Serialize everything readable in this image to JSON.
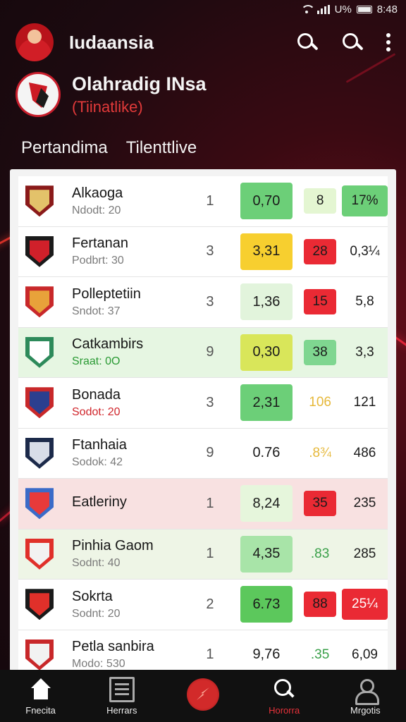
{
  "status_bar": {
    "battery": "U%",
    "time": "8:48"
  },
  "app": {
    "title": "Iudaansia"
  },
  "league": {
    "name": "Olahradig INsa",
    "subtitle": "(Tiinatlike)"
  },
  "tabs": [
    {
      "label": "Pertandima"
    },
    {
      "label": "Tilenttlive"
    }
  ],
  "standings": [
    {
      "team": "Alkaoga",
      "sub": "Ndodt: 20",
      "sub_color": "gray",
      "crest": [
        "#8a1a1a",
        "#e3c26a"
      ],
      "gp": "1",
      "odds": "0,70",
      "odds_bg": "#6ccf78",
      "v2": "8",
      "v2_bg": "#e4f6d2",
      "v3": "17%",
      "v3_bg": "#6ccf78",
      "row_bg": ""
    },
    {
      "team": "Fertanan",
      "sub": "Podbrt: 30",
      "sub_color": "gray",
      "crest": [
        "#1a1a1a",
        "#d0202a"
      ],
      "gp": "3",
      "odds": "3,31",
      "odds_bg": "#f7cf2f",
      "v2": "28",
      "v2_bg": "#ea2a34",
      "v3": "0,3¼",
      "v3_bg": "",
      "row_bg": ""
    },
    {
      "team": "Polleptetiin",
      "sub": "Sndot: 37",
      "sub_color": "gray",
      "crest": [
        "#c8282a",
        "#e8a23a"
      ],
      "gp": "3",
      "odds": "1,36",
      "odds_bg": "#e2f4dc",
      "v2": "15",
      "v2_bg": "#ea2a34",
      "v3": "5,8",
      "v3_bg": "",
      "row_bg": ""
    },
    {
      "team": "Catkambirs",
      "sub": "Sraat: 0O",
      "sub_color": "green",
      "crest": [
        "#2d8a5a",
        "#ffffff"
      ],
      "gp": "9",
      "odds": "0,30",
      "odds_bg": "#d9e65a",
      "v2": "38",
      "v2_bg": "#7fd690",
      "v3": "3,3",
      "v3_bg": "",
      "row_bg": "hl-green"
    },
    {
      "team": "Bonada",
      "sub": "Sodot: 20",
      "sub_color": "red",
      "crest": [
        "#c8282a",
        "#2b3f8f"
      ],
      "gp": "3",
      "odds": "2,31",
      "odds_bg": "#6ccf78",
      "v2": "106",
      "v2_bg": "",
      "v3": "121",
      "v3_bg": "",
      "row_bg": ""
    },
    {
      "team": "Ftanhaia",
      "sub": "Sodok: 42",
      "sub_color": "gray",
      "crest": [
        "#1c2a4a",
        "#d8dde8"
      ],
      "gp": "9",
      "odds": "0.76",
      "odds_bg": "",
      "v2": ".8¾",
      "v2_bg": "",
      "v3": "486",
      "v3_bg": "",
      "row_bg": ""
    },
    {
      "team": "Eatleriny",
      "sub": "",
      "sub_color": "gray",
      "crest": [
        "#3a6bc8",
        "#e83a3a"
      ],
      "gp": "1",
      "odds": "8,24",
      "odds_bg": "#e6f6dc",
      "v2": "35",
      "v2_bg": "#ea2a34",
      "v3": "235",
      "v3_bg": "",
      "row_bg": "hl-red"
    },
    {
      "team": "Pinhia Gaom",
      "sub": "Sodnt: 40",
      "sub_color": "gray",
      "crest": [
        "#e0302a",
        "#f2f2f2"
      ],
      "gp": "1",
      "odds": "4,35",
      "odds_bg": "#a8e4a8",
      "v2": ".83",
      "v2_bg": "",
      "v3": "285",
      "v3_bg": "",
      "row_bg": "hl-lime"
    },
    {
      "team": "Sokrta",
      "sub": "Sodnt: 20",
      "sub_color": "gray",
      "crest": [
        "#1a1a1a",
        "#e0302a"
      ],
      "gp": "2",
      "odds": "6.73",
      "odds_bg": "#5cc85c",
      "v2": "88",
      "v2_bg": "#ea2a34",
      "v3": "25¼",
      "v3_bg": "#ea2a34",
      "row_bg": ""
    },
    {
      "team": "Petla sanbira",
      "sub": "Modo: 530",
      "sub_color": "gray",
      "crest": [
        "#c8282a",
        "#f2f2f2"
      ],
      "gp": "1",
      "odds": "9,76",
      "odds_bg": "",
      "v2": ".35",
      "v2_bg": "",
      "v3": "6,09",
      "v3_bg": "",
      "row_bg": ""
    }
  ],
  "bottom_nav": [
    {
      "label": "Fnecita",
      "icon": "home-icon",
      "color": "white"
    },
    {
      "label": "Herrars",
      "icon": "list-icon",
      "color": "white"
    },
    {
      "label": "",
      "icon": "center-action-icon",
      "color": "white"
    },
    {
      "label": "Hororra",
      "icon": "search-icon",
      "color": "red"
    },
    {
      "label": "Mrgotis",
      "icon": "user-icon",
      "color": "white"
    }
  ]
}
